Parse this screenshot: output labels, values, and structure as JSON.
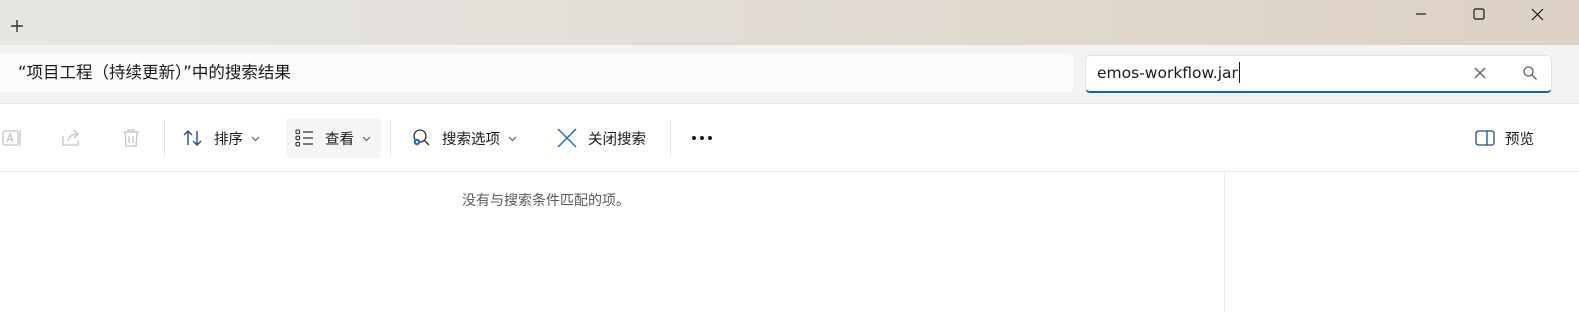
{
  "titlebar": {
    "new_tab_icon": "plus-icon",
    "minimize_icon": "minimize-icon",
    "maximize_icon": "maximize-icon",
    "close_icon": "close-icon"
  },
  "address": {
    "breadcrumb_text": "“项目工程（持续更新）”中的搜索结果"
  },
  "search": {
    "value": "emos-workflow.jar",
    "clear_icon": "clear-x-icon",
    "search_icon": "search-icon"
  },
  "toolbar": {
    "rename_icon": "rename-icon",
    "share_icon": "share-icon",
    "delete_icon": "delete-icon",
    "sort_label": "排序",
    "view_label": "查看",
    "search_options_label": "搜索选项",
    "close_search_label": "关闭搜索",
    "more_icon": "more-ellipsis-icon",
    "preview_label": "预览"
  },
  "content": {
    "empty_message": "没有与搜索条件匹配的项。"
  },
  "colors": {
    "accent": "#0a64b4",
    "disabled_icon": "#c4c4c4"
  }
}
